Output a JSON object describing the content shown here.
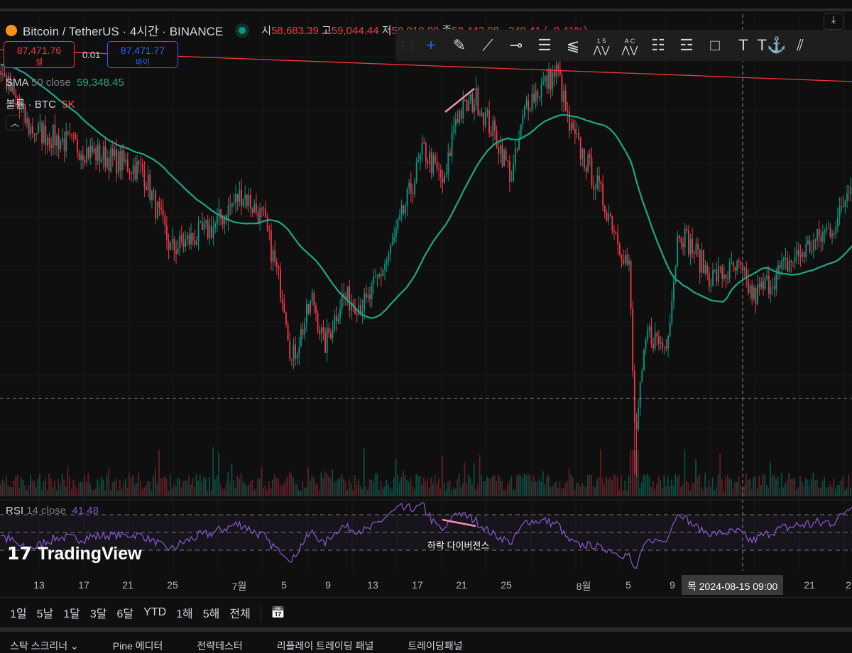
{
  "legend": {
    "symbol": "Bitcoin / TetherUS · 4시간 · BINANCE",
    "o_label": "시",
    "o": "58,683.39",
    "h_label": "고",
    "h": "59,044.44",
    "l_label": "저",
    "l": "58,010.00",
    "c_label": "종",
    "c": "58,442.98",
    "change": "−240.41 (−0.41%)"
  },
  "trade": {
    "sell_price": "87,471.76",
    "sell_label": "셀",
    "spread": "0.01",
    "buy_price": "87,471.77",
    "buy_label": "바이"
  },
  "indicators": {
    "sma_name": "SMA",
    "sma_params": "50 close",
    "sma_value": "59,348.45",
    "vol_name": "볼륨 · BTC",
    "vol_value": "5K",
    "rsi_name": "RSI",
    "rsi_params": "14 close",
    "rsi_value": "41.48"
  },
  "drawing_tools": [
    "grip-icon",
    "crosshair-icon",
    "brush-icon",
    "trendline-icon",
    "horizontal-ray-icon",
    "parallel-channel-icon",
    "pitchfork-icon",
    "xabcd-pattern-icon",
    "abcd-pattern-icon",
    "fib-retracement-icon",
    "fib-extension-icon",
    "rectangle-icon",
    "text-icon",
    "anchored-text-icon",
    "multi-line-icon"
  ],
  "pattern_labels": {
    "one": "1",
    "five": "5",
    "a": "A",
    "c": "C"
  },
  "annotation": "하락 다이버전스",
  "logo": "TradingView",
  "time_axis": {
    "ticks": [
      [
        "13",
        55
      ],
      [
        "17",
        118
      ],
      [
        "21",
        180
      ],
      [
        "25",
        243
      ],
      [
        "7월",
        337
      ],
      [
        "5",
        400
      ],
      [
        "9",
        462
      ],
      [
        "13",
        525
      ],
      [
        "17",
        588
      ],
      [
        "21",
        650
      ],
      [
        "25",
        713
      ],
      [
        "8월",
        822
      ],
      [
        "5",
        885
      ],
      [
        "9",
        947
      ],
      [
        "21",
        1140
      ],
      [
        "2",
        1195
      ]
    ],
    "crosshair": "목 2024-08-15  09:00"
  },
  "ranges": [
    "1일",
    "5날",
    "1달",
    "3달",
    "6달",
    "YTD",
    "1해",
    "5해",
    "전체"
  ],
  "bottom_tabs": [
    "스탁 스크리너 ⌄",
    "Pine 에디터",
    "전략테스터",
    "리플레이 트레이딩 패널",
    "트레이딩패널"
  ],
  "colors": {
    "up": "#089981",
    "down": "#f23645",
    "sma": "#1fa687",
    "rsi": "#7e57c2",
    "trendline": "#f23645",
    "divergence": "#f48fb1"
  },
  "chart_data": {
    "type": "candlestick",
    "interval": "4h",
    "bars_per_day": 6,
    "price_path": [
      [
        0,
        69800
      ],
      [
        2.5,
        66700
      ],
      [
        7.6,
        65500
      ],
      [
        12.7,
        64400
      ],
      [
        15.2,
        60100
      ],
      [
        19,
        61300
      ],
      [
        21.6,
        63200
      ],
      [
        23.5,
        61700
      ],
      [
        25.4,
        57100
      ],
      [
        26,
        54000
      ],
      [
        27.9,
        57500
      ],
      [
        28.9,
        54800
      ],
      [
        30.5,
        57500
      ],
      [
        32.7,
        57100
      ],
      [
        34.9,
        60100
      ],
      [
        37.8,
        65500
      ],
      [
        39.7,
        63600
      ],
      [
        40.6,
        67300
      ],
      [
        42.5,
        68300
      ],
      [
        44.4,
        66000
      ],
      [
        45.7,
        64000
      ],
      [
        47,
        68100
      ],
      [
        49.8,
        69800
      ],
      [
        50.8,
        66700
      ],
      [
        52.7,
        64400
      ],
      [
        54.6,
        61700
      ],
      [
        56.2,
        59000
      ],
      [
        56.7,
        49800
      ],
      [
        57.8,
        55600
      ],
      [
        59.4,
        54800
      ],
      [
        60,
        57500
      ],
      [
        60.6,
        61300
      ],
      [
        63.5,
        58600
      ],
      [
        66,
        59000
      ],
      [
        67.3,
        57500
      ],
      [
        70.5,
        59400
      ],
      [
        73,
        60600
      ],
      [
        74.9,
        61700
      ],
      [
        76.2,
        64400
      ]
    ],
    "sma_period": 50,
    "rsi_period": 14,
    "rsi_levels": [
      70,
      50,
      30
    ]
  }
}
